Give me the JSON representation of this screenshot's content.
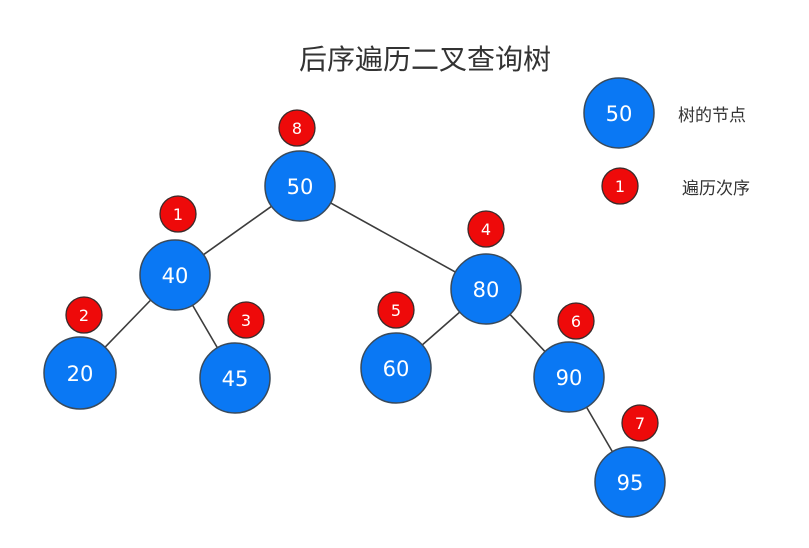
{
  "title": "后序遍历二叉查询树",
  "colors": {
    "node_fill": "#0a78f4",
    "node_stroke": "#3a4a5a",
    "order_fill": "#ee0a0a",
    "order_stroke": "#3a2a2a",
    "edge": "#3c3c3c",
    "text": "#ffffff"
  },
  "legend": {
    "node_sample": "50",
    "node_label": "树的节点",
    "order_sample": "1",
    "order_label": "遍历次序"
  },
  "nodes": [
    {
      "id": "n50",
      "value": "50",
      "order": "8"
    },
    {
      "id": "n40",
      "value": "40",
      "order": "1"
    },
    {
      "id": "n80",
      "value": "80",
      "order": "4"
    },
    {
      "id": "n20",
      "value": "20",
      "order": "2"
    },
    {
      "id": "n45",
      "value": "45",
      "order": "3"
    },
    {
      "id": "n60",
      "value": "60",
      "order": "5"
    },
    {
      "id": "n90",
      "value": "90",
      "order": "6"
    },
    {
      "id": "n95",
      "value": "95",
      "order": "7"
    }
  ],
  "edges": [
    [
      "n50",
      "n40"
    ],
    [
      "n50",
      "n80"
    ],
    [
      "n40",
      "n20"
    ],
    [
      "n40",
      "n45"
    ],
    [
      "n80",
      "n60"
    ],
    [
      "n80",
      "n90"
    ],
    [
      "n90",
      "n95"
    ]
  ]
}
